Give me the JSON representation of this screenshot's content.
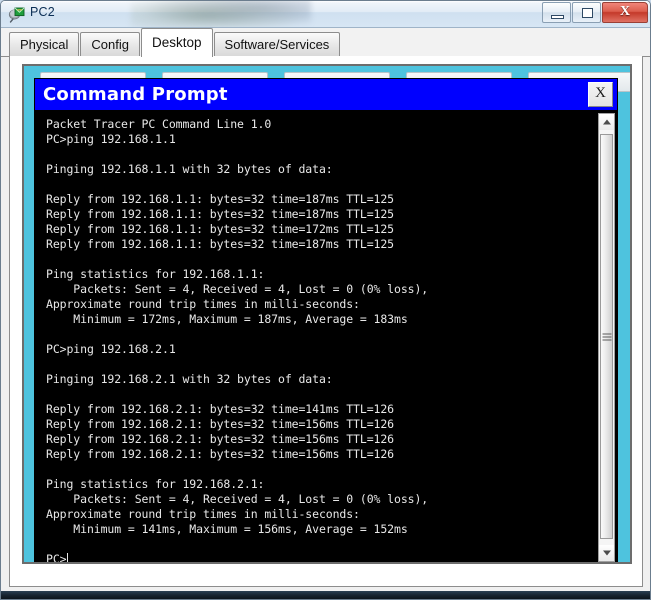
{
  "window": {
    "title": "PC2",
    "icon": "pc-device-icon",
    "controls": {
      "minimize_label": "Minimize",
      "maximize_label": "Maximize",
      "close_label": "X"
    }
  },
  "tabs": [
    {
      "label": "Physical",
      "active": false
    },
    {
      "label": "Config",
      "active": false
    },
    {
      "label": "Desktop",
      "active": true
    },
    {
      "label": "Software/Services",
      "active": false
    }
  ],
  "desktop": {
    "background_color": "#4ec3de",
    "icon_count": 5
  },
  "command_prompt": {
    "title": "Command Prompt",
    "title_bar_color": "#0000ff",
    "close_label": "X",
    "terminal_background": "#000000",
    "terminal_foreground": "#e8e8e8",
    "prompt": "PC>",
    "lines": [
      "Packet Tracer PC Command Line 1.0",
      "PC>ping 192.168.1.1",
      "",
      "Pinging 192.168.1.1 with 32 bytes of data:",
      "",
      "Reply from 192.168.1.1: bytes=32 time=187ms TTL=125",
      "Reply from 192.168.1.1: bytes=32 time=187ms TTL=125",
      "Reply from 192.168.1.1: bytes=32 time=172ms TTL=125",
      "Reply from 192.168.1.1: bytes=32 time=187ms TTL=125",
      "",
      "Ping statistics for 192.168.1.1:",
      "    Packets: Sent = 4, Received = 4, Lost = 0 (0% loss),",
      "Approximate round trip times in milli-seconds:",
      "    Minimum = 172ms, Maximum = 187ms, Average = 183ms",
      "",
      "PC>ping 192.168.2.1",
      "",
      "Pinging 192.168.2.1 with 32 bytes of data:",
      "",
      "Reply from 192.168.2.1: bytes=32 time=141ms TTL=126",
      "Reply from 192.168.2.1: bytes=32 time=156ms TTL=126",
      "Reply from 192.168.2.1: bytes=32 time=156ms TTL=126",
      "Reply from 192.168.2.1: bytes=32 time=156ms TTL=126",
      "",
      "Ping statistics for 192.168.2.1:",
      "    Packets: Sent = 4, Received = 4, Lost = 0 (0% loss),",
      "Approximate round trip times in milli-seconds:",
      "    Minimum = 141ms, Maximum = 156ms, Average = 152ms",
      "",
      "PC>"
    ],
    "scrollbar": {
      "up_arrow": "scroll-up-arrow",
      "down_arrow": "scroll-down-arrow"
    }
  }
}
